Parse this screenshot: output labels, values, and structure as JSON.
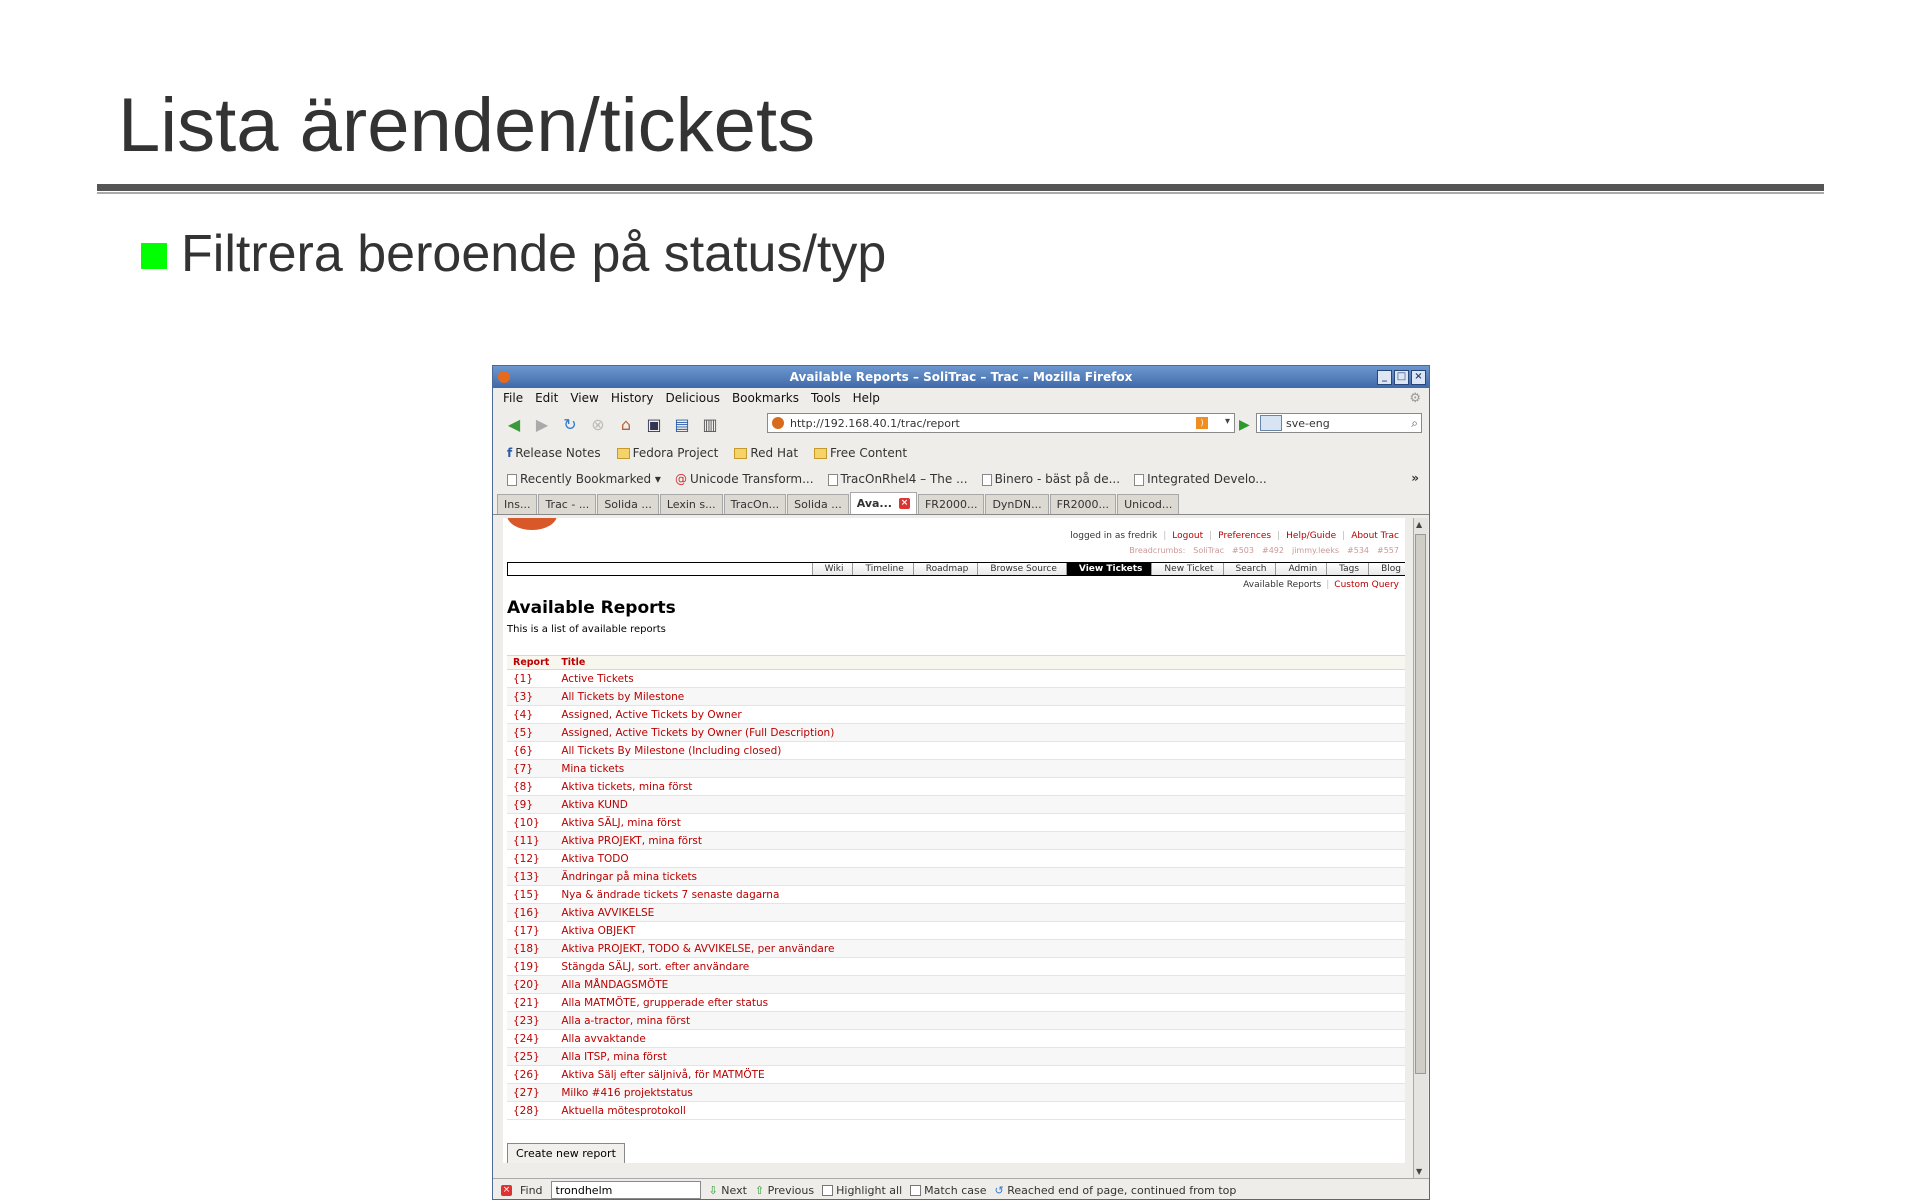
{
  "slide": {
    "title": "Lista ärenden/tickets",
    "bullet": "Filtrera beroende på status/typ",
    "accent": "#00ff00"
  },
  "browser": {
    "window_title": "Available Reports – SoliTrac – Trac – Mozilla Firefox",
    "menu": [
      "File",
      "Edit",
      "View",
      "History",
      "Delicious",
      "Bookmarks",
      "Tools",
      "Help"
    ],
    "url": "http://192.168.40.1/trac/report",
    "search_value": "sve-eng",
    "bookmarks": [
      "Release Notes",
      "Fedora Project",
      "Red Hat",
      "Free Content"
    ],
    "bookmarks2": [
      "Recently Bookmarked",
      "Unicode Transform...",
      "TracOnRhel4 – The ...",
      "Binero - bäst på de...",
      "Integrated Develo..."
    ],
    "tabs": [
      "Ins...",
      "Trac - ...",
      "Solida ...",
      "Lexin s...",
      "TracOn...",
      "Solida ...",
      "Ava...",
      "FR2000...",
      "DynDN...",
      "FR2000...",
      "Unicod..."
    ],
    "active_tab_index": 6
  },
  "trac": {
    "logged_in": "logged in as fredrik",
    "meta": [
      "Logout",
      "Preferences",
      "Help/Guide",
      "About Trac"
    ],
    "crumbs": [
      "Breadcrumbs:",
      "SoliTrac",
      "#503",
      "#492",
      "jimmy.leeks",
      "#534",
      "#557"
    ],
    "mainnav": [
      "Wiki",
      "Timeline",
      "Roadmap",
      "Browse Source",
      "View Tickets",
      "New Ticket",
      "Search",
      "Admin",
      "Tags",
      "Blog"
    ],
    "active_nav": "View Tickets",
    "ctxnav": [
      "Available Reports",
      "Custom Query"
    ],
    "heading": "Available Reports",
    "intro": "This is a list of available reports",
    "columns": [
      "Report",
      "Title"
    ],
    "reports": [
      {
        "num": "{1}",
        "title": "Active Tickets"
      },
      {
        "num": "{3}",
        "title": "All Tickets by Milestone"
      },
      {
        "num": "{4}",
        "title": "Assigned, Active Tickets by Owner"
      },
      {
        "num": "{5}",
        "title": "Assigned, Active Tickets by Owner (Full Description)"
      },
      {
        "num": "{6}",
        "title": "All Tickets By Milestone (Including closed)"
      },
      {
        "num": "{7}",
        "title": "Mina tickets"
      },
      {
        "num": "{8}",
        "title": "Aktiva tickets, mina först"
      },
      {
        "num": "{9}",
        "title": "Aktiva KUND"
      },
      {
        "num": "{10}",
        "title": "Aktiva SÄLJ, mina först"
      },
      {
        "num": "{11}",
        "title": "Aktiva PROJEKT, mina först"
      },
      {
        "num": "{12}",
        "title": "Aktiva TODO"
      },
      {
        "num": "{13}",
        "title": "Ändringar på mina tickets"
      },
      {
        "num": "{15}",
        "title": "Nya & ändrade tickets 7 senaste dagarna"
      },
      {
        "num": "{16}",
        "title": "Aktiva AVVIKELSE"
      },
      {
        "num": "{17}",
        "title": "Aktiva OBJEKT"
      },
      {
        "num": "{18}",
        "title": "Aktiva PROJEKT, TODO & AVVIKELSE, per användare"
      },
      {
        "num": "{19}",
        "title": "Stängda SÄLJ, sort. efter användare"
      },
      {
        "num": "{20}",
        "title": "Alla MÅNDAGSMÖTE"
      },
      {
        "num": "{21}",
        "title": "Alla MATMÖTE, grupperade efter status"
      },
      {
        "num": "{23}",
        "title": "Alla a-tractor, mina först"
      },
      {
        "num": "{24}",
        "title": "Alla avvaktande"
      },
      {
        "num": "{25}",
        "title": "Alla ITSP, mina först"
      },
      {
        "num": "{26}",
        "title": "Aktiva Sälj efter säljnivå, för MATMÖTE"
      },
      {
        "num": "{27}",
        "title": "Milko #416 projektstatus"
      },
      {
        "num": "{28}",
        "title": "Aktuella mötesprotokoll"
      }
    ],
    "new_report_button": "Create new report"
  },
  "findbar": {
    "label": "Find",
    "value": "trondhelm",
    "next": "Next",
    "previous": "Previous",
    "highlight": "Highlight all",
    "match_case": "Match case",
    "status": "Reached end of page, continued from top"
  }
}
